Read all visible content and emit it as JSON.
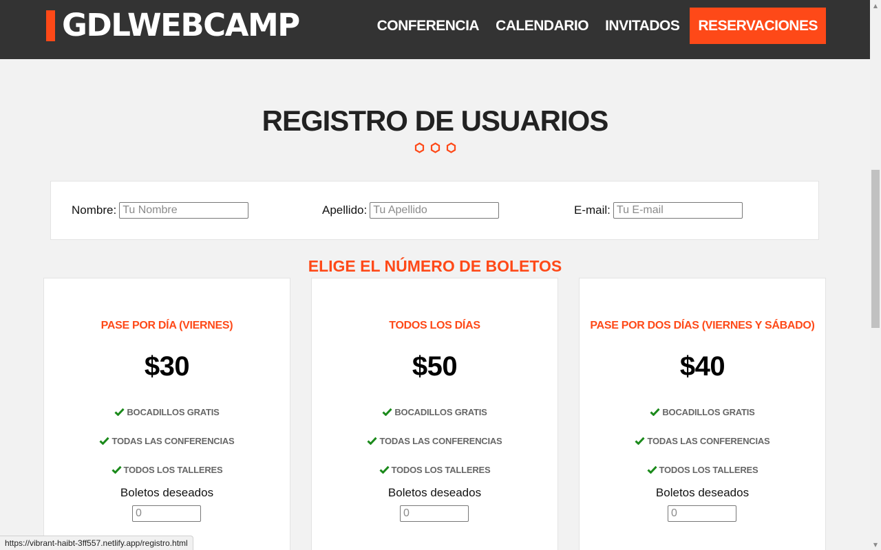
{
  "header": {
    "logo_text": "GDLWEBCAMP",
    "nav": [
      {
        "label": "CONFERENCIA",
        "active": false
      },
      {
        "label": "CALENDARIO",
        "active": false
      },
      {
        "label": "INVITADOS",
        "active": false
      },
      {
        "label": "RESERVACIONES",
        "active": true
      }
    ]
  },
  "page": {
    "title": "REGISTRO DE USUARIOS",
    "accent_color": "#fe4918",
    "header_bg": "#333333"
  },
  "user_form": {
    "fields": [
      {
        "label": "Nombre:",
        "placeholder": "Tu Nombre",
        "value": ""
      },
      {
        "label": "Apellido:",
        "placeholder": "Tu Apellido",
        "value": ""
      },
      {
        "label": "E-mail:",
        "placeholder": "Tu E-mail",
        "value": ""
      }
    ]
  },
  "tickets": {
    "heading": "ELIGE EL NÚMERO DE BOLETOS",
    "quantity_label": "Boletos deseados",
    "quantity_placeholder": "0",
    "cards": [
      {
        "title": "PASE POR DÍA (VIERNES)",
        "price": "$30",
        "features": [
          "BOCADILLOS GRATIS",
          "TODAS LAS CONFERENCIAS",
          "TODOS LOS TALLERES"
        ]
      },
      {
        "title": "TODOS LOS DÍAS",
        "price": "$50",
        "features": [
          "BOCADILLOS GRATIS",
          "TODAS LAS CONFERENCIAS",
          "TODOS LOS TALLERES"
        ]
      },
      {
        "title": "PASE POR DOS DÍAS (VIERNES Y SÁBADO)",
        "price": "$40",
        "features": [
          "BOCADILLOS GRATIS",
          "TODAS LAS CONFERENCIAS",
          "TODOS LOS TALLERES"
        ]
      }
    ]
  },
  "status_bar": {
    "url": "https://vibrant-haibt-3ff557.netlify.app/registro.html"
  }
}
